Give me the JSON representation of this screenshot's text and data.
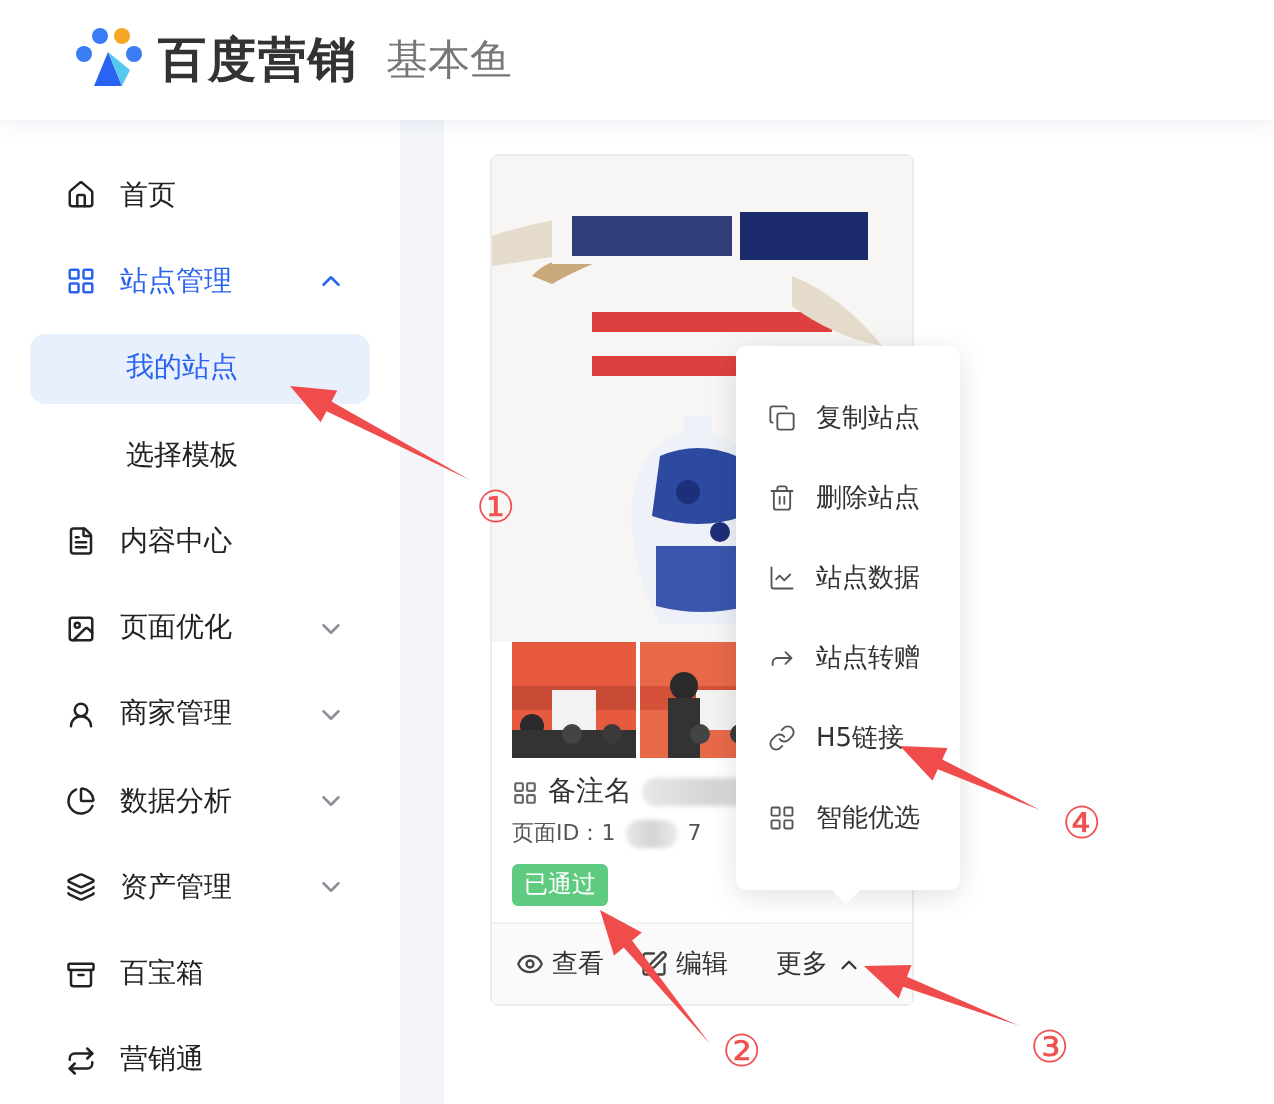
{
  "header": {
    "brand": "百度营销",
    "product": "基本鱼"
  },
  "sidebar": {
    "items": [
      {
        "label": "首页",
        "selected": false
      },
      {
        "label": "站点管理",
        "expanded": true,
        "children": [
          {
            "label": "我的站点",
            "selected": true
          },
          {
            "label": "选择模板",
            "selected": false
          }
        ]
      },
      {
        "label": "内容中心",
        "selected": false
      },
      {
        "label": "页面优化",
        "selected": false,
        "expanded": false
      },
      {
        "label": "商家管理",
        "selected": false,
        "expanded": false
      },
      {
        "label": "数据分析",
        "selected": false,
        "expanded": false
      },
      {
        "label": "资产管理",
        "selected": false,
        "expanded": false
      },
      {
        "label": "百宝箱",
        "selected": false
      },
      {
        "label": "营销通",
        "selected": false
      }
    ]
  },
  "site_card": {
    "name_label": "备注名",
    "page_id": "页面ID：1",
    "page_id_end": "7",
    "status": "已通过",
    "actions": [
      {
        "kind": "view",
        "label": "查看"
      },
      {
        "kind": "edit",
        "label": "编辑"
      },
      {
        "kind": "more",
        "label": "更多",
        "expanded": true
      }
    ]
  },
  "more_menu": {
    "items": [
      {
        "kind": "copy",
        "label": "复制站点"
      },
      {
        "kind": "delete",
        "label": "删除站点"
      },
      {
        "kind": "data",
        "label": "站点数据"
      },
      {
        "kind": "transfer",
        "label": "站点转赠"
      },
      {
        "kind": "link",
        "label": "H5链接"
      },
      {
        "kind": "smart",
        "label": "智能优选"
      }
    ]
  },
  "annotations": [
    "①",
    "②",
    "③",
    "④"
  ]
}
